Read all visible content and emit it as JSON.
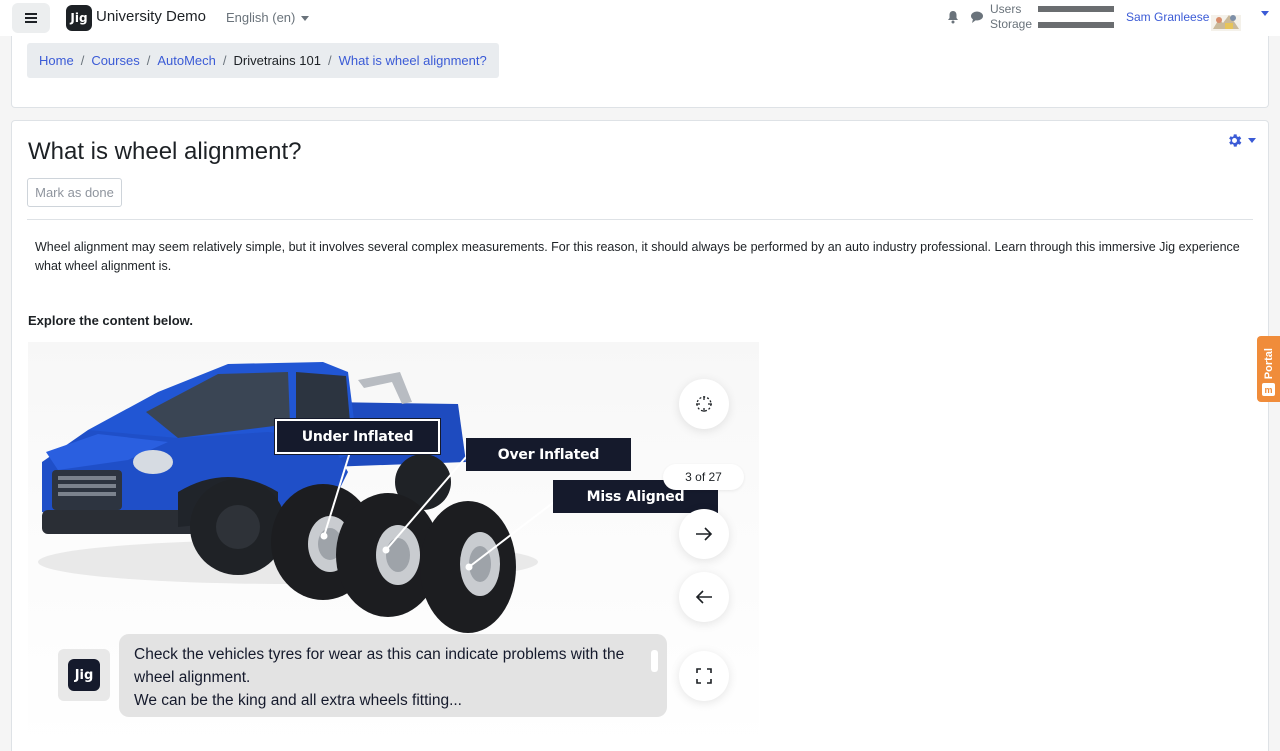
{
  "navbar": {
    "site_name": "University Demo",
    "logo_text": "Jig",
    "language": "English (en)",
    "quota_labels": [
      "Users",
      "Storage"
    ],
    "user_name": "Sam Granleese"
  },
  "breadcrumb": {
    "items": [
      "Home",
      "Courses",
      "AutoMech",
      "Drivetrains 101",
      "What is wheel alignment?"
    ],
    "separator": "/"
  },
  "page": {
    "title": "What is wheel alignment?",
    "mark_done_label": "Mark as done",
    "intro": "Wheel alignment may seem relatively simple, but it involves several complex measurements. For this reason, it should always be performed by an auto industry professional. Learn through this immersive Jig experience what wheel alignment is.",
    "explore_label": "Explore the content below."
  },
  "viewer": {
    "hotspots": [
      "Under Inflated",
      "Over Inflated",
      "Miss Aligned"
    ],
    "counter": "3 of 27",
    "caption": "Check the vehicles tyres for wear as this can indicate problems with the wheel alignment.",
    "caption_overflow": "We can be the king and all extra wheels fitting...",
    "badge_text": "Jig"
  },
  "portal": {
    "label": "Portal",
    "icon_text": "m"
  },
  "colors": {
    "link": "#3b5bd6",
    "hotspot_bg": "#151a2c",
    "truck_blue": "#1f4fc8",
    "portal_orange": "#f08c3a"
  },
  "icons": [
    "hamburger-icon",
    "bell-icon",
    "chat-icon",
    "gear-icon",
    "recenter-icon",
    "arrow-right-icon",
    "arrow-left-icon",
    "fullscreen-icon"
  ]
}
